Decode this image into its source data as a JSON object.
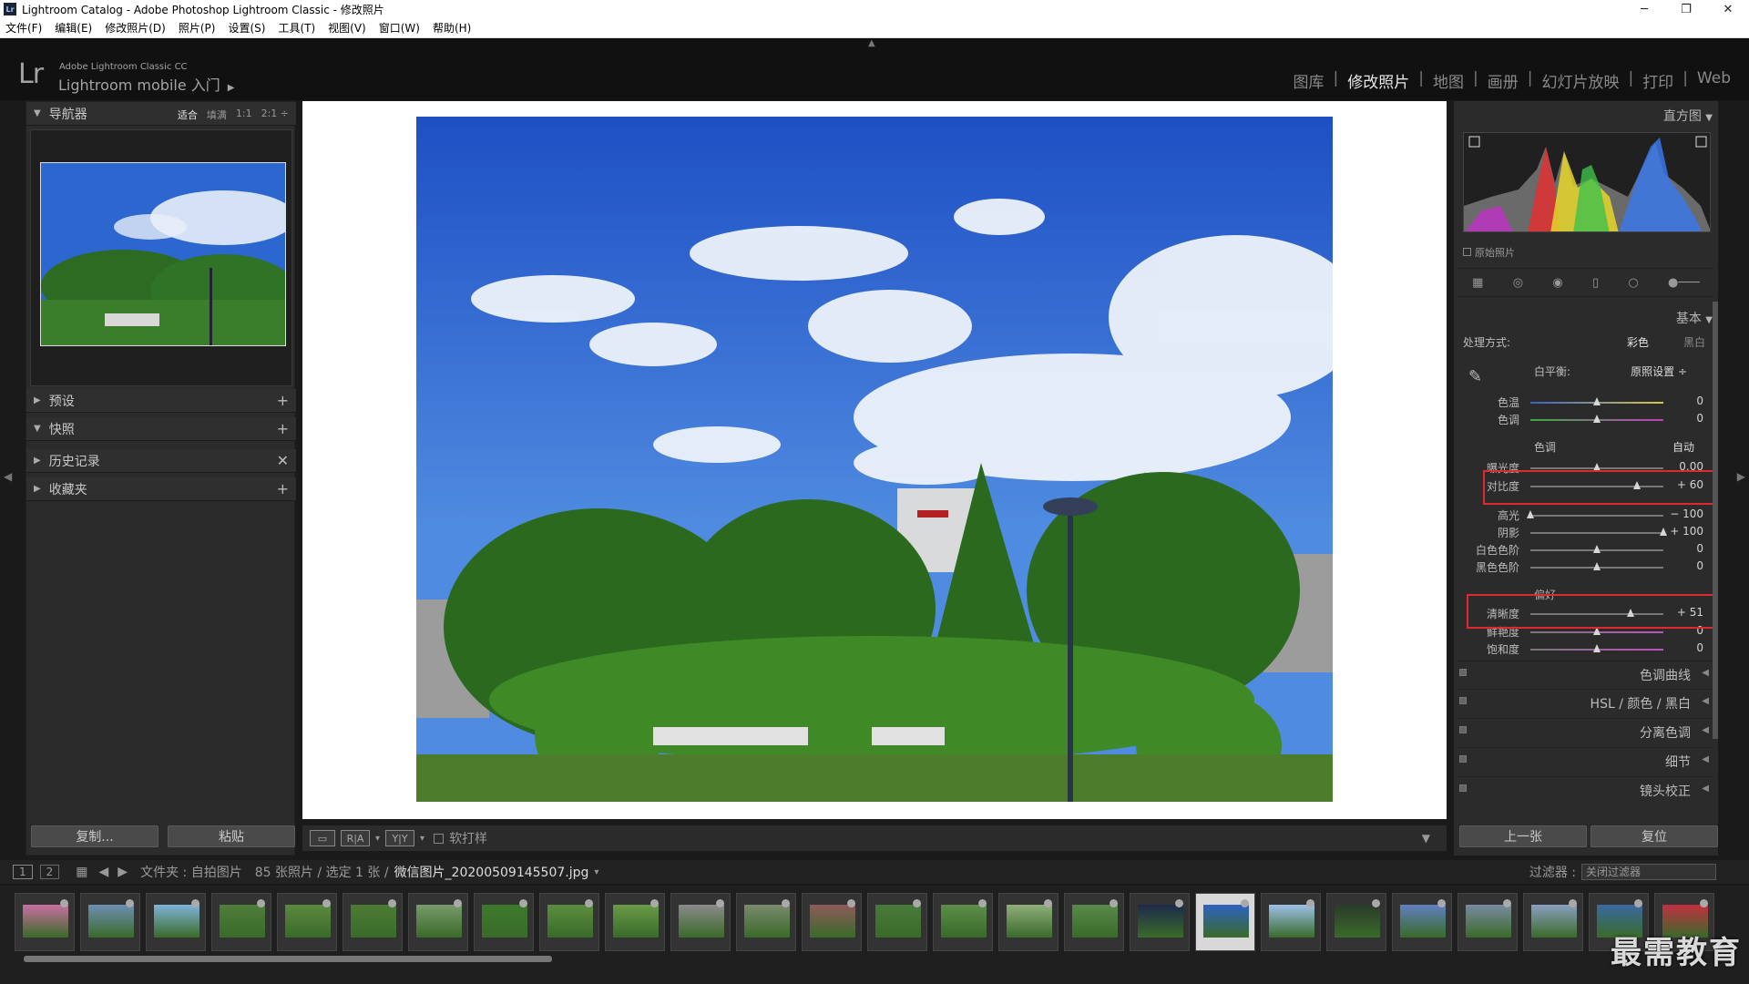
{
  "window": {
    "title": "Lightroom Catalog - Adobe Photoshop Lightroom Classic - 修改照片",
    "logo": "Lr",
    "minimize": "─",
    "maximize": "❐",
    "close": "✕"
  },
  "menu": [
    "文件(F)",
    "编辑(E)",
    "修改照片(D)",
    "照片(P)",
    "设置(S)",
    "工具(T)",
    "视图(V)",
    "窗口(W)",
    "帮助(H)"
  ],
  "identity": {
    "logo": "Lr",
    "line1": "Adobe Lightroom Classic CC",
    "line2": "Lightroom mobile 入门",
    "arrow": "▶"
  },
  "modules": [
    {
      "label": "图库",
      "active": false
    },
    {
      "label": "修改照片",
      "active": true
    },
    {
      "label": "地图",
      "active": false
    },
    {
      "label": "画册",
      "active": false
    },
    {
      "label": "幻灯片放映",
      "active": false
    },
    {
      "label": "打印",
      "active": false
    },
    {
      "label": "Web",
      "active": false
    }
  ],
  "module_separator": "|",
  "left": {
    "navigator": {
      "title": "导航器",
      "zoom": [
        "适合",
        "填满",
        "1:1",
        "2:1 ÷"
      ]
    },
    "panels": [
      {
        "title": "预设",
        "action": "+"
      },
      {
        "title": "快照",
        "action": "+"
      },
      {
        "title": "历史记录",
        "action": "✕"
      },
      {
        "title": "收藏夹",
        "action": "+"
      }
    ],
    "copy_button": "复制...",
    "paste_button": "粘贴"
  },
  "toolbar": {
    "compare1": "R|A",
    "compare2": "Y|Y",
    "softproof_label": "软打样"
  },
  "right": {
    "histogram_title": "直方图",
    "original_photo": "原始照片",
    "basic_title": "基本",
    "treatment_label": "处理方式:",
    "treatment_color": "彩色",
    "treatment_bw": "黑白",
    "wb_label": "白平衡:",
    "wb_value": "原照设置 ÷",
    "tone_label": "色调",
    "auto_label": "自动",
    "presence_label": "偏好",
    "sliders": [
      {
        "label": "色温",
        "value": "0",
        "pos": 0.5
      },
      {
        "label": "色调",
        "value": "0",
        "pos": 0.5
      },
      {
        "label": "曝光度",
        "value": "0.00",
        "pos": 0.5
      },
      {
        "label": "对比度",
        "value": "+ 60",
        "pos": 0.8
      },
      {
        "label": "高光",
        "value": "− 100",
        "pos": 0.0
      },
      {
        "label": "阴影",
        "value": "+ 100",
        "pos": 1.0
      },
      {
        "label": "白色色阶",
        "value": "0",
        "pos": 0.5
      },
      {
        "label": "黑色色阶",
        "value": "0",
        "pos": 0.5
      },
      {
        "label": "清晰度",
        "value": "+ 51",
        "pos": 0.755
      },
      {
        "label": "鲜艳度",
        "value": "0",
        "pos": 0.5
      },
      {
        "label": "饱和度",
        "value": "0",
        "pos": 0.5
      }
    ],
    "collapsed_panels": [
      "色调曲线",
      "HSL / 颜色 / 黑白",
      "分离色调",
      "细节",
      "镜头校正"
    ],
    "prev_button": "上一张",
    "reset_button": "复位"
  },
  "filmbar": {
    "page1": "1",
    "page2": "2",
    "source": "文件夹 : 自拍图片",
    "count": "85 张照片 / 选定 1 张 /",
    "filename": "微信图片_20200509145507.jpg",
    "filter_label": "过滤器 :",
    "filter_value": "关闭过滤器"
  },
  "watermark": "最需教育",
  "colors": {
    "accent_red": "#e0282d",
    "panel_bg": "#2b2b2b",
    "top_bg": "#111111"
  }
}
